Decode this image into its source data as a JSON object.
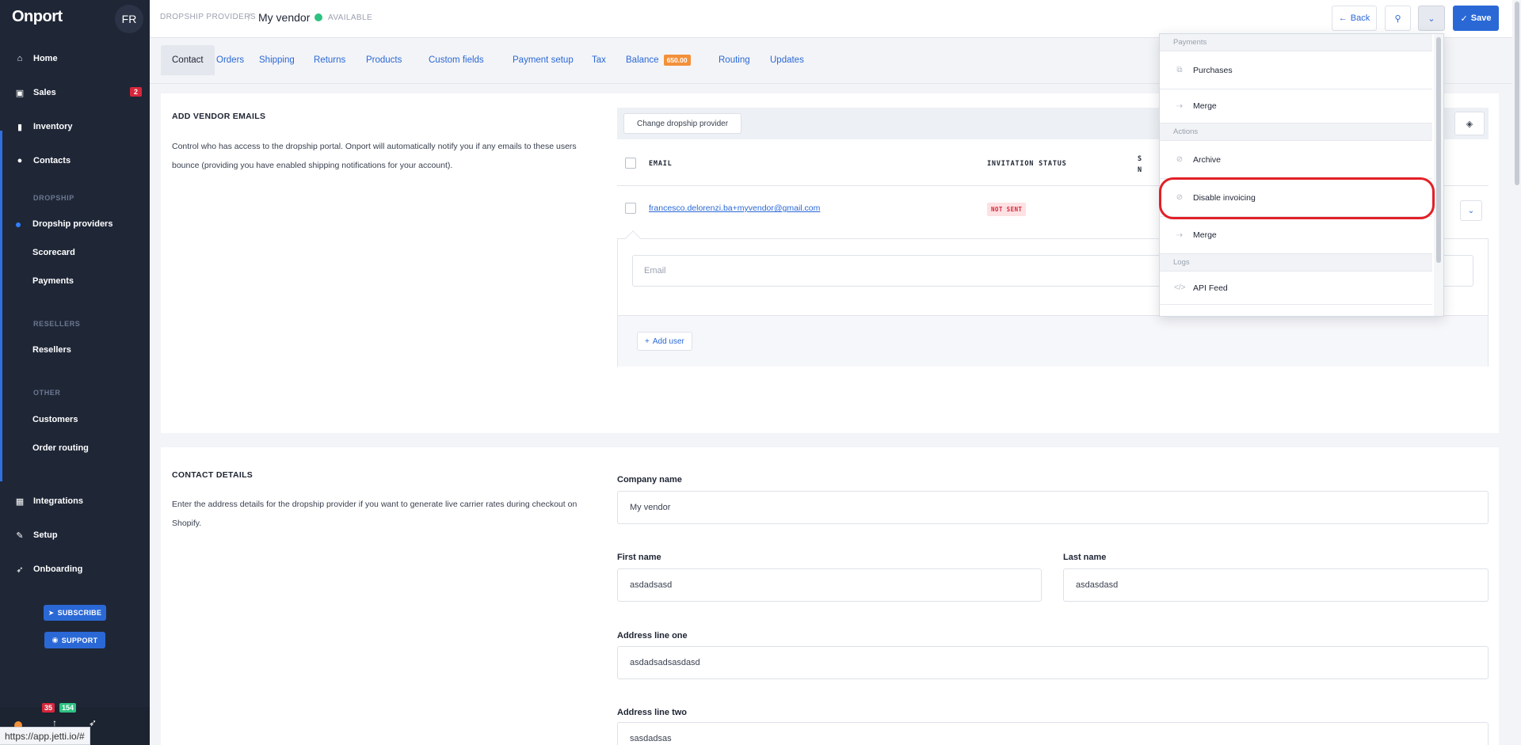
{
  "sidebar": {
    "brand": "Onport",
    "avatar": "FR",
    "nav": [
      {
        "label": "Home",
        "icon": "home-icon"
      },
      {
        "label": "Sales",
        "icon": "cart-icon",
        "badge": "2"
      },
      {
        "label": "Inventory",
        "icon": "bookmark-icon"
      },
      {
        "label": "Contacts",
        "icon": "user-icon"
      }
    ],
    "sections": {
      "dropship": "DROPSHIP",
      "resellers": "RESELLERS",
      "other": "OTHER"
    },
    "sub_items": {
      "dropship_providers": "Dropship providers",
      "scorecard": "Scorecard",
      "payments": "Payments",
      "resellers": "Resellers",
      "customers": "Customers",
      "order_routing": "Order routing"
    },
    "nav_bottom": [
      {
        "label": "Integrations",
        "icon": "grid-icon"
      },
      {
        "label": "Setup",
        "icon": "wrench-icon"
      },
      {
        "label": "Onboarding",
        "icon": "rocket-icon"
      }
    ],
    "subscribe": "SUBSCRIBE",
    "support": "SUPPORT",
    "footer_badges": {
      "red": "35",
      "green": "154"
    }
  },
  "status_url": "https://app.jetti.io/#",
  "topbar": {
    "breadcrumb": "DROPSHIP PROVIDERS",
    "title": "My vendor",
    "status": "AVAILABLE",
    "back": "Back",
    "save": "Save"
  },
  "tabs": [
    {
      "label": "Contact"
    },
    {
      "label": "Orders"
    },
    {
      "label": "Shipping"
    },
    {
      "label": "Returns"
    },
    {
      "label": "Products"
    },
    {
      "label": "Custom fields"
    },
    {
      "label": "Payment setup"
    },
    {
      "label": "Tax"
    },
    {
      "label": "Balance",
      "badge": "650.00"
    },
    {
      "label": "Routing"
    },
    {
      "label": "Updates"
    }
  ],
  "vendor_emails": {
    "title": "ADD VENDOR EMAILS",
    "description": "Control who has access to the dropship portal. Onport will automatically notify you if any emails to these users bounce (providing you have enabled shipping notifications for your account).",
    "change_provider": "Change dropship provider",
    "col_email": "EMAIL",
    "col_status": "INVITATION STATUS",
    "col_partial": "S",
    "col_partial2": "N",
    "rows": [
      {
        "email": "francesco.delorenzi.ba+myvendor@gmail.com",
        "status": "NOT SENT"
      }
    ],
    "email_placeholder": "Email",
    "add_user": "Add user"
  },
  "contact_details": {
    "title": "CONTACT DETAILS",
    "description": "Enter the address details for the dropship provider if you want to generate live carrier rates during checkout on Shopify.",
    "company_label": "Company name",
    "company_value": "My vendor",
    "first_label": "First name",
    "first_value": "asdadsasd",
    "last_label": "Last name",
    "last_value": "asdasdasd",
    "addr1_label": "Address line one",
    "addr1_value": "asdadsadsasdasd",
    "addr2_label": "Address line two",
    "addr2_value": "sasdadsas"
  },
  "menu": {
    "hdr_payments": "Payments",
    "purchases": "Purchases",
    "merge1": "Merge",
    "hdr_actions": "Actions",
    "archive": "Archive",
    "disable_invoicing": "Disable invoicing",
    "merge2": "Merge",
    "hdr_logs": "Logs",
    "api_feed": "API Feed"
  },
  "colors": {
    "sidebar_bg": "#1f2737",
    "accent": "#2a68d6",
    "available": "#2ec282",
    "badge_red": "#d8263b",
    "balance_badge": "#f3903a",
    "highlight": "#e22027"
  }
}
